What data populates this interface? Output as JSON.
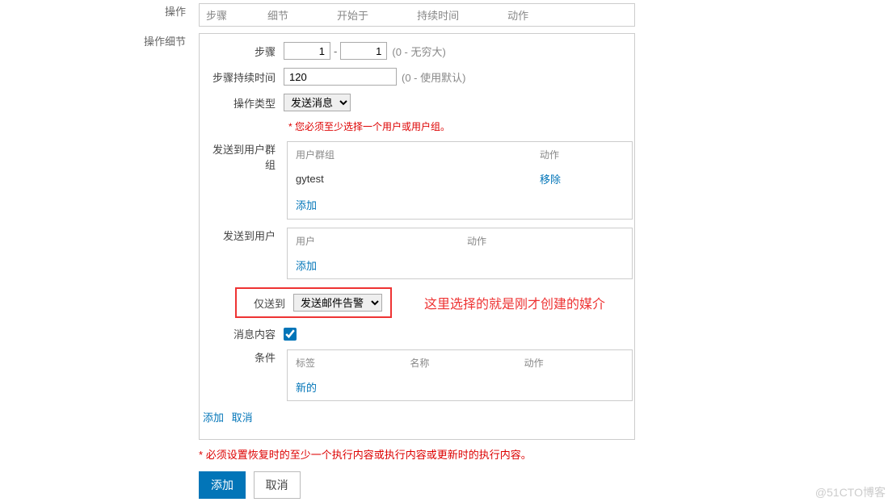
{
  "top": {
    "operations_label": "操作",
    "tabs": [
      "步骤",
      "细节",
      "开始于",
      "持续时间",
      "动作"
    ]
  },
  "details": {
    "section_label": "操作细节",
    "steps_label": "步骤",
    "steps_from": "1",
    "steps_to": "1",
    "steps_hint": "(0 - 无穷大)",
    "duration_label": "步骤持续时间",
    "duration_value": "120",
    "duration_hint": "(0 - 使用默认)",
    "op_type_label": "操作类型",
    "op_type_value": "发送消息",
    "req_note": "您必须至少选择一个用户或用户组。",
    "send_group_label": "发送到用户群组",
    "group_table": {
      "col_group": "用户群组",
      "col_action": "动作",
      "row_group": "gytest",
      "row_action": "移除",
      "add": "添加"
    },
    "send_user_label": "发送到用户",
    "user_table": {
      "col_user": "用户",
      "col_action": "动作",
      "add": "添加"
    },
    "send_to_label": "仅送到",
    "send_to_value": "发送邮件告警",
    "annotation": "这里选择的就是刚才创建的媒介",
    "msg_content_label": "消息内容",
    "msg_content_checked": true,
    "cond_label": "条件",
    "cond_table": {
      "col_tag": "标签",
      "col_name": "名称",
      "col_action": "动作",
      "new": "新的"
    },
    "bottom_add": "添加",
    "bottom_cancel": "取消"
  },
  "footer": {
    "error": "必须设置恢复时的至少一个执行内容或执行内容或更新时的执行内容。",
    "btn_add": "添加",
    "btn_cancel": "取消"
  },
  "watermark": "@51CTO博客"
}
